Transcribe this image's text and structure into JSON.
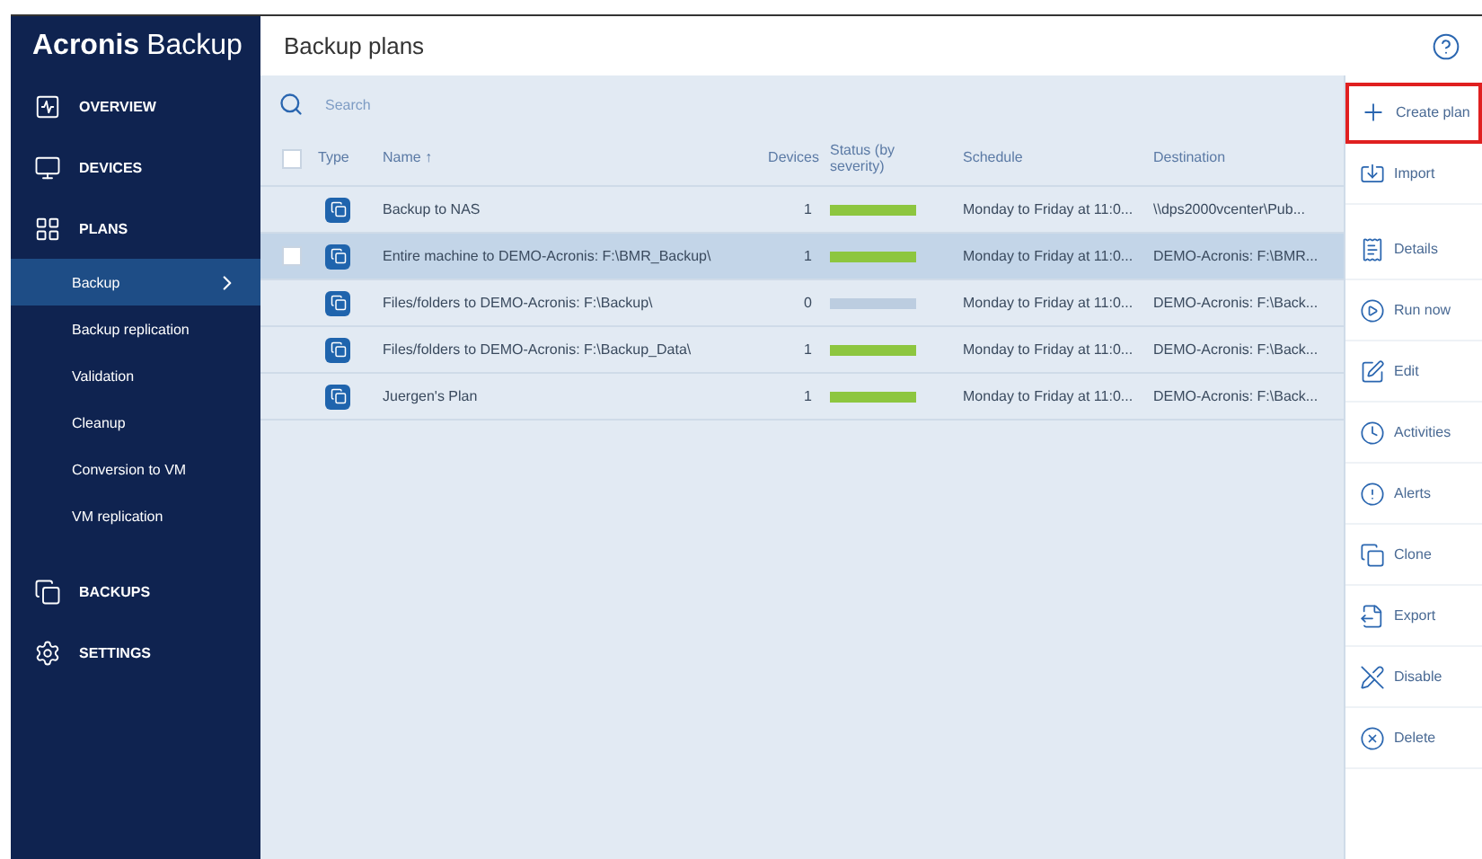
{
  "logo": {
    "brand": "Acronis",
    "product": "Backup"
  },
  "page_title": "Backup plans",
  "sidebar": {
    "items": [
      {
        "label": "OVERVIEW",
        "selected": false
      },
      {
        "label": "DEVICES",
        "selected": false
      },
      {
        "label": "PLANS",
        "selected": false,
        "children": [
          {
            "label": "Backup",
            "selected": true
          },
          {
            "label": "Backup replication",
            "selected": false
          },
          {
            "label": "Validation",
            "selected": false
          },
          {
            "label": "Cleanup",
            "selected": false
          },
          {
            "label": "Conversion to VM",
            "selected": false
          },
          {
            "label": "VM replication",
            "selected": false
          }
        ]
      },
      {
        "label": "BACKUPS",
        "selected": false
      },
      {
        "label": "SETTINGS",
        "selected": false
      }
    ]
  },
  "search": {
    "placeholder": "Search"
  },
  "table": {
    "select_all": {
      "checked": false
    },
    "columns": [
      "Type",
      "Name ↑",
      "Devices",
      "Status (by severity)",
      "Schedule",
      "Destination"
    ],
    "rows": [
      {
        "name": "Backup to NAS",
        "devices": "1",
        "color": "#8dc63f",
        "schedule": "Monday to Friday at 11:0...",
        "destination": "\\\\dps2000vcenter\\Pub...",
        "selected": false
      },
      {
        "name": "Entire machine to DEMO-Acronis: F:\\BMR_Backup\\",
        "devices": "1",
        "color": "#8dc63f",
        "schedule": "Monday to Friday at 11:0...",
        "destination": "DEMO-Acronis: F:\\BMR...",
        "selected": true
      },
      {
        "name": "Files/folders to DEMO-Acronis: F:\\Backup\\",
        "devices": "0",
        "color": "#bccde0",
        "schedule": "Monday to Friday at 11:0...",
        "destination": "DEMO-Acronis: F:\\Back...",
        "selected": false
      },
      {
        "name": "Files/folders to DEMO-Acronis: F:\\Backup_Data\\",
        "devices": "1",
        "color": "#8dc63f",
        "schedule": "Monday to Friday at 11:0...",
        "destination": "DEMO-Acronis: F:\\Back...",
        "selected": false
      },
      {
        "name": "Juergen's Plan",
        "devices": "1",
        "color": "#8dc63f",
        "schedule": "Monday to Friday at 11:0...",
        "destination": "DEMO-Acronis: F:\\Back...",
        "selected": false
      }
    ]
  },
  "actions": [
    {
      "label": "Create plan",
      "highlighted": true
    },
    {
      "label": "Import",
      "highlighted": false
    },
    {
      "label": "Details",
      "highlighted": false
    },
    {
      "label": "Run now",
      "highlighted": false
    },
    {
      "label": "Edit",
      "highlighted": false
    },
    {
      "label": "Activities",
      "highlighted": false
    },
    {
      "label": "Alerts",
      "highlighted": false
    },
    {
      "label": "Clone",
      "highlighted": false
    },
    {
      "label": "Export",
      "highlighted": false
    },
    {
      "label": "Disable",
      "highlighted": false
    },
    {
      "label": "Delete",
      "highlighted": false
    }
  ]
}
